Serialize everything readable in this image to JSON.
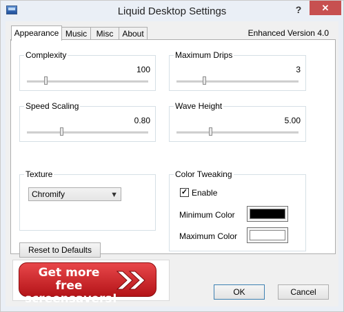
{
  "window": {
    "title": "Liquid Desktop Settings",
    "help_label": "?",
    "close_label": "✕"
  },
  "tabs": [
    {
      "label": "Appearance",
      "active": true
    },
    {
      "label": "Music"
    },
    {
      "label": "Misc"
    },
    {
      "label": "About"
    }
  ],
  "version_label": "Enhanced Version 4.0",
  "sliders": {
    "complexity": {
      "label": "Complexity",
      "value": "100"
    },
    "maximum_drips": {
      "label": "Maximum Drips",
      "value": "3"
    },
    "speed_scaling": {
      "label": "Speed Scaling",
      "value": "0.80"
    },
    "wave_height": {
      "label": "Wave Height",
      "value": "5.00"
    }
  },
  "texture": {
    "label": "Texture",
    "selected": "Chromify"
  },
  "color_tweaking": {
    "label": "Color Tweaking",
    "enable_label": "Enable",
    "enabled": true,
    "min_label": "Minimum Color",
    "min_color": "#000000",
    "max_label": "Maximum Color",
    "max_color": "#ffffff"
  },
  "buttons": {
    "reset": "Reset to Defaults",
    "ok": "OK",
    "cancel": "Cancel"
  },
  "banner": {
    "text_line1": "Get more free",
    "text_line2": "screensavers!",
    "color": "#d42a2e"
  },
  "colors": {
    "title_close_bg": "#c75050",
    "panel_bg": "#ffffff",
    "dialog_bg": "#f0f0f0"
  }
}
